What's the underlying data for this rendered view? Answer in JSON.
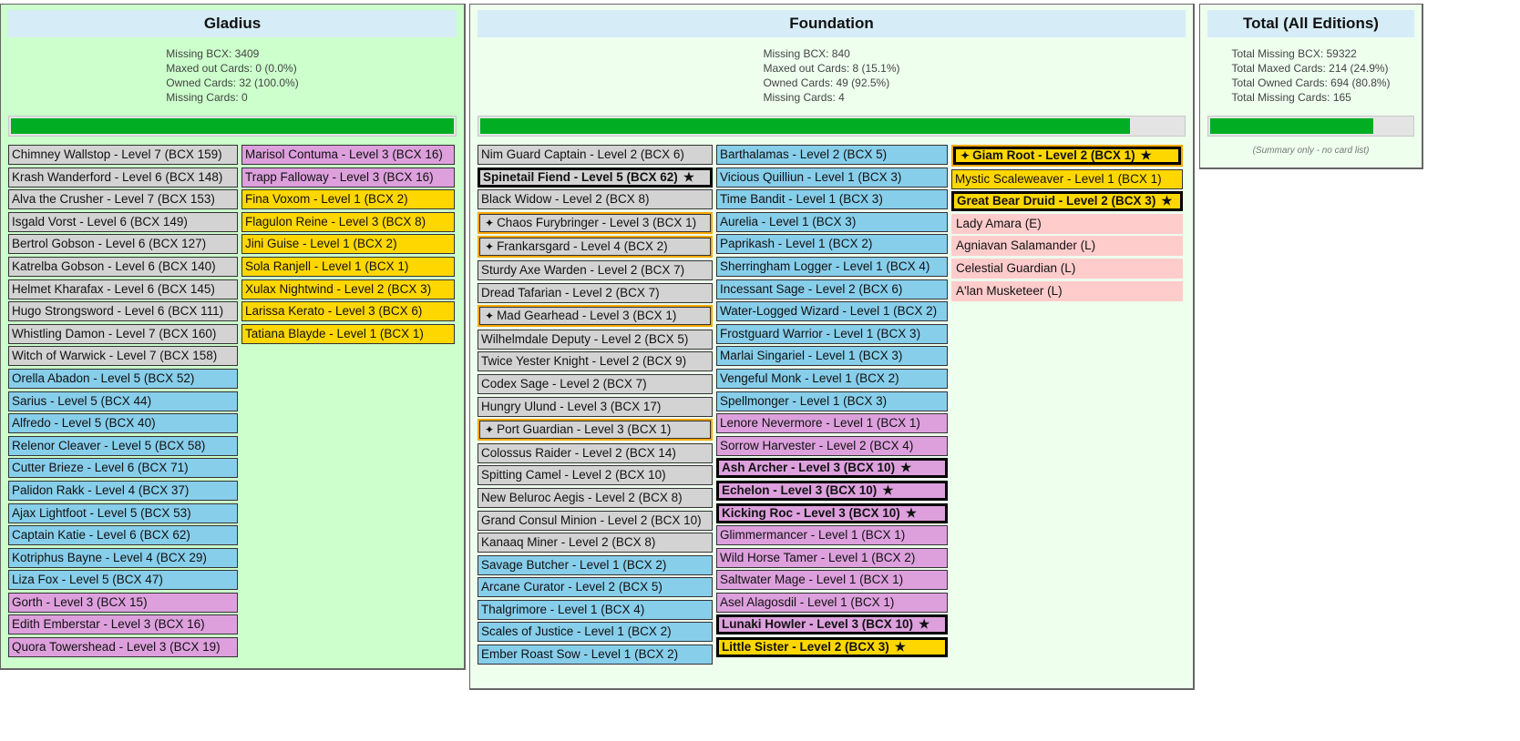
{
  "gladius": {
    "title": "Gladius",
    "stats": [
      "Missing BCX: 3409",
      "Maxed out Cards: 0 (0.0%)",
      "Owned Cards: 32 (100.0%)",
      "Missing Cards: 0"
    ],
    "progress_percent": 100,
    "columns": [
      [
        {
          "t": "Chimney Wallstop - Level 7 (BCX 159)",
          "c": "gray"
        },
        {
          "t": "Krash Wanderford - Level 6 (BCX 148)",
          "c": "gray"
        },
        {
          "t": "Alva the Crusher - Level 7 (BCX 153)",
          "c": "gray"
        },
        {
          "t": "Isgald Vorst - Level 6 (BCX 149)",
          "c": "gray"
        },
        {
          "t": "Bertrol Gobson - Level 6 (BCX 127)",
          "c": "gray"
        },
        {
          "t": "Katrelba Gobson - Level 6 (BCX 140)",
          "c": "gray"
        },
        {
          "t": "Helmet Kharafax - Level 6 (BCX 145)",
          "c": "gray"
        },
        {
          "t": "Hugo Strongsword - Level 6 (BCX 111)",
          "c": "gray"
        },
        {
          "t": "Whistling Damon - Level 7 (BCX 160)",
          "c": "gray"
        },
        {
          "t": "Witch of Warwick - Level 7 (BCX 158)",
          "c": "gray"
        },
        {
          "t": "Orella Abadon - Level 5 (BCX 52)",
          "c": "blue"
        },
        {
          "t": "Sarius - Level 5 (BCX 44)",
          "c": "blue"
        },
        {
          "t": "Alfredo - Level 5 (BCX 40)",
          "c": "blue"
        },
        {
          "t": "Relenor Cleaver - Level 5 (BCX 58)",
          "c": "blue"
        },
        {
          "t": "Cutter Brieze - Level 6 (BCX 71)",
          "c": "blue"
        },
        {
          "t": "Palidon Rakk - Level 4 (BCX 37)",
          "c": "blue"
        },
        {
          "t": "Ajax Lightfoot - Level 5 (BCX 53)",
          "c": "blue"
        },
        {
          "t": "Captain Katie - Level 6 (BCX 62)",
          "c": "blue"
        },
        {
          "t": "Kotriphus Bayne - Level 4 (BCX 29)",
          "c": "blue"
        },
        {
          "t": "Liza Fox - Level 5 (BCX 47)",
          "c": "blue"
        },
        {
          "t": "Gorth - Level 3 (BCX 15)",
          "c": "plum"
        },
        {
          "t": "Edith Emberstar - Level 3 (BCX 16)",
          "c": "plum"
        },
        {
          "t": "Quora Towershead - Level 3 (BCX 19)",
          "c": "plum"
        }
      ],
      [
        {
          "t": "Marisol Contuma - Level 3 (BCX 16)",
          "c": "plum"
        },
        {
          "t": "Trapp Falloway - Level 3 (BCX 16)",
          "c": "plum"
        },
        {
          "t": "Fina Voxom - Level 1 (BCX 2)",
          "c": "gold"
        },
        {
          "t": "Flagulon Reine - Level 3 (BCX 8)",
          "c": "gold"
        },
        {
          "t": "Jini Guise - Level 1 (BCX 2)",
          "c": "gold"
        },
        {
          "t": "Sola Ranjell - Level 1 (BCX 1)",
          "c": "gold"
        },
        {
          "t": "Xulax Nightwind - Level 2 (BCX 3)",
          "c": "gold"
        },
        {
          "t": "Larissa Kerato - Level 3 (BCX 6)",
          "c": "gold"
        },
        {
          "t": "Tatiana Blayde - Level 1 (BCX 1)",
          "c": "gold"
        }
      ]
    ]
  },
  "foundation": {
    "title": "Foundation",
    "stats": [
      "Missing BCX: 840",
      "Maxed out Cards: 8 (15.1%)",
      "Owned Cards: 49 (92.5%)",
      "Missing Cards: 4"
    ],
    "progress_percent": 92.5,
    "columns": [
      [
        {
          "t": "Nim Guard Captain - Level 2 (BCX 6)",
          "c": "gray"
        },
        {
          "t": "Spinetail Fiend - Level 5 (BCX 62)",
          "c": "gray",
          "maxed": true
        },
        {
          "t": "Black Widow - Level 2 (BCX 8)",
          "c": "gray"
        },
        {
          "t": "Chaos Furybringer - Level 3 (BCX 1)",
          "c": "gray",
          "foil": true
        },
        {
          "t": "Frankarsgard - Level 4 (BCX 2)",
          "c": "gray",
          "foil": true
        },
        {
          "t": "Sturdy Axe Warden - Level 2 (BCX 7)",
          "c": "gray"
        },
        {
          "t": "Dread Tafarian - Level 2 (BCX 7)",
          "c": "gray"
        },
        {
          "t": "Mad Gearhead - Level 3 (BCX 1)",
          "c": "gray",
          "foil": true
        },
        {
          "t": "Wilhelmdale Deputy - Level 2 (BCX 5)",
          "c": "gray"
        },
        {
          "t": "Twice Yester Knight - Level 2 (BCX 9)",
          "c": "gray"
        },
        {
          "t": "Codex Sage - Level 2 (BCX 7)",
          "c": "gray"
        },
        {
          "t": "Hungry Ulund - Level 3 (BCX 17)",
          "c": "gray"
        },
        {
          "t": "Port Guardian - Level 3 (BCX 1)",
          "c": "gray",
          "foil": true
        },
        {
          "t": "Colossus Raider - Level 2 (BCX 14)",
          "c": "gray"
        },
        {
          "t": "Spitting Camel - Level 2 (BCX 10)",
          "c": "gray"
        },
        {
          "t": "New Beluroc Aegis - Level 2 (BCX 8)",
          "c": "gray"
        },
        {
          "t": "Grand Consul Minion - Level 2 (BCX 10)",
          "c": "gray"
        },
        {
          "t": "Kanaaq Miner - Level 2 (BCX 8)",
          "c": "gray"
        },
        {
          "t": "Savage Butcher - Level 1 (BCX 2)",
          "c": "blue"
        },
        {
          "t": "Arcane Curator - Level 2 (BCX 5)",
          "c": "blue"
        },
        {
          "t": "Thalgrimore - Level 1 (BCX 4)",
          "c": "blue"
        },
        {
          "t": "Scales of Justice - Level 1 (BCX 2)",
          "c": "blue"
        },
        {
          "t": "Ember Roast Sow - Level 1 (BCX 2)",
          "c": "blue"
        }
      ],
      [
        {
          "t": "Barthalamas - Level 2 (BCX 5)",
          "c": "blue"
        },
        {
          "t": "Vicious Quilliun - Level 1 (BCX 3)",
          "c": "blue"
        },
        {
          "t": "Time Bandit - Level 1 (BCX 3)",
          "c": "blue"
        },
        {
          "t": "Aurelia - Level 1 (BCX 3)",
          "c": "blue"
        },
        {
          "t": "Paprikash - Level 1 (BCX 2)",
          "c": "blue"
        },
        {
          "t": "Sherringham Logger - Level 1 (BCX 4)",
          "c": "blue"
        },
        {
          "t": "Incessant Sage - Level 2 (BCX 6)",
          "c": "blue"
        },
        {
          "t": "Water-Logged Wizard - Level 1 (BCX 2)",
          "c": "blue"
        },
        {
          "t": "Frostguard Warrior - Level 1 (BCX 3)",
          "c": "blue"
        },
        {
          "t": "Marlai Singariel - Level 1 (BCX 3)",
          "c": "blue"
        },
        {
          "t": "Vengeful Monk - Level 1 (BCX 2)",
          "c": "blue"
        },
        {
          "t": "Spellmonger - Level 1 (BCX 3)",
          "c": "blue"
        },
        {
          "t": "Lenore Nevermore - Level 1 (BCX 1)",
          "c": "plum"
        },
        {
          "t": "Sorrow Harvester - Level 2 (BCX 4)",
          "c": "plum"
        },
        {
          "t": "Ash Archer - Level 3 (BCX 10)",
          "c": "plum",
          "maxed": true
        },
        {
          "t": "Echelon - Level 3 (BCX 10)",
          "c": "plum",
          "maxed": true
        },
        {
          "t": "Kicking Roc - Level 3 (BCX 10)",
          "c": "plum",
          "maxed": true
        },
        {
          "t": "Glimmermancer - Level 1 (BCX 1)",
          "c": "plum"
        },
        {
          "t": "Wild Horse Tamer - Level 1 (BCX 2)",
          "c": "plum"
        },
        {
          "t": "Saltwater Mage - Level 1 (BCX 1)",
          "c": "plum"
        },
        {
          "t": "Asel Alagosdil - Level 1 (BCX 1)",
          "c": "plum"
        },
        {
          "t": "Lunaki Howler - Level 3 (BCX 10)",
          "c": "plum",
          "maxed": true
        },
        {
          "t": "Little Sister - Level 2 (BCX 3)",
          "c": "gold",
          "maxed": true
        }
      ],
      [
        {
          "t": "Giam Root - Level 2 (BCX 1)",
          "c": "gold",
          "maxed": true,
          "foil": true
        },
        {
          "t": "Mystic Scaleweaver - Level 1 (BCX 1)",
          "c": "gold"
        },
        {
          "t": "Great Bear Druid - Level 2 (BCX 3)",
          "c": "gold",
          "maxed": true
        },
        {
          "t": "Lady Amara (E)",
          "c": "missing"
        },
        {
          "t": "Agniavan Salamander (L)",
          "c": "missing"
        },
        {
          "t": "Celestial Guardian (L)",
          "c": "missing"
        },
        {
          "t": "A'lan Musketeer (L)",
          "c": "missing"
        }
      ]
    ]
  },
  "total": {
    "title": "Total (All Editions)",
    "stats": [
      "Total Missing BCX: 59322",
      "Total Maxed Cards: 214 (24.9%)",
      "Total Owned Cards: 694 (80.8%)",
      "Total Missing Cards: 165"
    ],
    "progress_percent": 80.8,
    "note": "(Summary only - no card list)"
  },
  "icons": {
    "maxed": "star-icon",
    "foil": "sparkle-icon"
  },
  "colors": {
    "gray": "#d3d3d3",
    "blue": "#87ceeb",
    "plum": "#dda0dd",
    "gold": "#ffd700",
    "missing": "#ffcccc",
    "progress": "#00ad23"
  }
}
